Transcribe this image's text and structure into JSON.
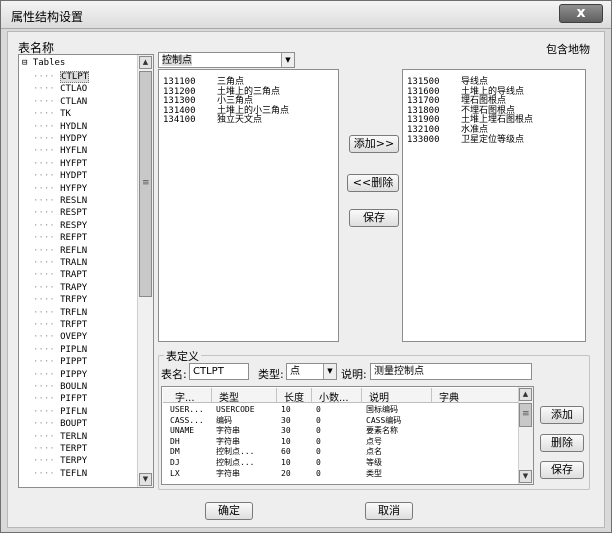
{
  "window": {
    "title": "属性结构设置",
    "close_glyph": "x"
  },
  "left_panel": {
    "label": "表名称",
    "root": "Tables",
    "root_toggle": "⊟",
    "selected": "CTLPT",
    "items": [
      "CTLPT",
      "CTLAO",
      "CTLAN",
      "TK",
      "HYDLN",
      "HYDPY",
      "HYFLN",
      "HYFPT",
      "HYDPT",
      "HYFPY",
      "RESLN",
      "RESPT",
      "RESPY",
      "REFPT",
      "REFLN",
      "TRALN",
      "TRAPT",
      "TRAPY",
      "TRFPY",
      "TRFLN",
      "TRFPT",
      "OVEPY",
      "PIPLN",
      "PIPPT",
      "PIPPY",
      "BOULN",
      "PIFPT",
      "PIFLN",
      "BOUPT",
      "TERLN",
      "TERPT",
      "TERPY",
      "TEFLN"
    ]
  },
  "top_right_label": "包含地物",
  "category_select": {
    "value": "控制点"
  },
  "available_list": [
    {
      "code": "131100",
      "name": "三角点"
    },
    {
      "code": "131200",
      "name": "土堆上的三角点"
    },
    {
      "code": "131300",
      "name": "小三角点"
    },
    {
      "code": "131400",
      "name": "土堆上的小三角点"
    },
    {
      "code": "134100",
      "name": "独立天文点"
    }
  ],
  "included_list": [
    {
      "code": "131500",
      "name": "导线点"
    },
    {
      "code": "131600",
      "name": "土堆上的导线点"
    },
    {
      "code": "131700",
      "name": "埋石图根点"
    },
    {
      "code": "131800",
      "name": "不埋石图根点"
    },
    {
      "code": "131900",
      "name": "土堆上埋石图根点"
    },
    {
      "code": "132100",
      "name": "水准点"
    },
    {
      "code": "133000",
      "name": "卫星定位等级点"
    }
  ],
  "middle_buttons": {
    "add": "添加>>",
    "delete": "<<删除",
    "save": "保存"
  },
  "table_def": {
    "group_label": "表定义",
    "name_label": "表名:",
    "name_value": "CTLPT",
    "type_label": "类型:",
    "type_value": "点",
    "desc_label": "说明:",
    "desc_value": "测量控制点",
    "headers": [
      "字...",
      "类型",
      "长度",
      "小数...",
      "说明",
      "字典"
    ],
    "rows": [
      [
        "USER...",
        "USERCODE",
        "10",
        "0",
        "国标编码",
        ""
      ],
      [
        "CASS...",
        "编码",
        "30",
        "0",
        "CASS编码",
        ""
      ],
      [
        "UNAME",
        "字符串",
        "30",
        "0",
        "要素名称",
        ""
      ],
      [
        "DH",
        "字符串",
        "10",
        "0",
        "点号",
        ""
      ],
      [
        "DM",
        "控制点...",
        "60",
        "0",
        "点名",
        ""
      ],
      [
        "DJ",
        "控制点...",
        "10",
        "0",
        "等级",
        ""
      ],
      [
        "LX",
        "字符串",
        "20",
        "0",
        "类型",
        ""
      ]
    ],
    "buttons": {
      "add": "添加",
      "delete": "删除",
      "save": "保存"
    }
  },
  "footer": {
    "ok": "确定",
    "cancel": "取消"
  },
  "glyphs": {
    "up": "▲",
    "down": "▼",
    "grip": "≡"
  }
}
